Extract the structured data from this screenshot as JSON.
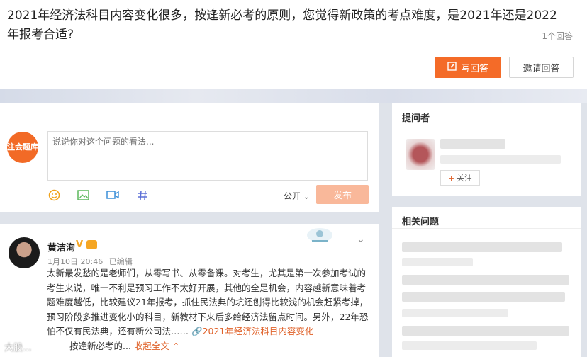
{
  "question": {
    "title": "2021年经济法科目内容变化很多，按逢新必考的原则，您觉得新政策的考点难度，是2021年还是2022年报考合适?",
    "answer_count": "1个回答",
    "write_label": "写回答",
    "invite_label": "邀请回答"
  },
  "compose": {
    "logo_text": "注会题库",
    "placeholder": "说说你对这个问题的看法...",
    "visibility": "公开",
    "publish_label": "发布",
    "tools": [
      "emoji-icon",
      "image-icon",
      "video-icon",
      "hashtag-icon"
    ]
  },
  "answer": {
    "user_name": "黄洁洵",
    "date": "1月10日 20:46",
    "edited": "已编辑",
    "body": "太新最发愁的是老师们，从零写书、从零备课。对考生，尤其是第一次参加考试的考生来说，唯一不利是预习工作不太好开展，其他的全是机会，内容越新意味着考题难度越低，比较建议21年报考，抓住民法典的坑还刨得比较浅的机会赶紧考掉，预习阶段多推进变化小的科目，新教材下来后多给经济法留点时间。另外，22年恐怕不仅有民法典，还有新公司法……",
    "link_text": "2021年经济法科目内容变化",
    "trailing": "按逢新必考的...",
    "collapse_label": "收起全文"
  },
  "sidebar": {
    "asker_title": "提问者",
    "follow_label": "关注",
    "related_title": "相关问题"
  },
  "watermark": "大股...",
  "colors": {
    "accent": "#f46b28",
    "publish_disabled": "#f9b89a"
  }
}
